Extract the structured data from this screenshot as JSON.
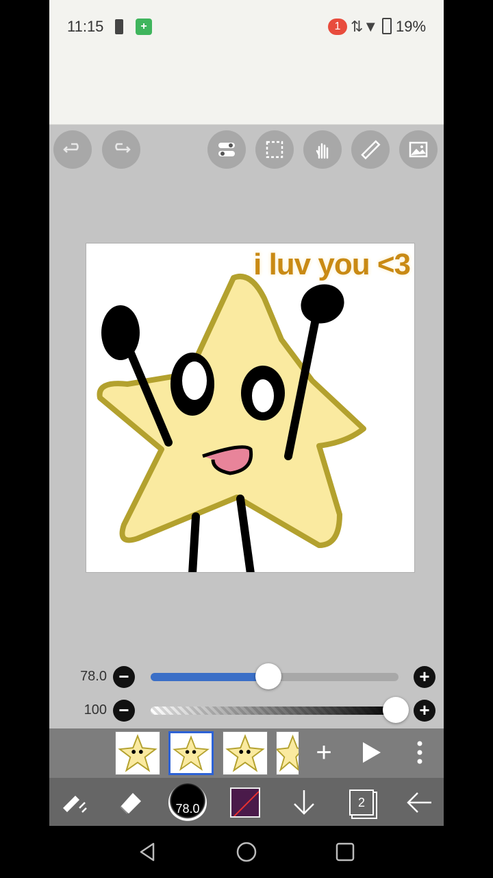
{
  "status_bar": {
    "time": "11:15",
    "notification_count": "1",
    "battery_percent": "19%"
  },
  "toolbar": {
    "undo": "undo-icon",
    "redo": "redo-icon",
    "tools": [
      "toggle-icon",
      "selection-icon",
      "hand-icon",
      "ruler-icon",
      "image-icon"
    ]
  },
  "canvas": {
    "caption": "i luv you <3"
  },
  "brush_size_slider": {
    "value": "78.0",
    "fraction": 0.475
  },
  "opacity_slider": {
    "value": "100",
    "fraction": 1.0
  },
  "frames": {
    "selected_index": 1,
    "count": 4
  },
  "bottom_toolbar": {
    "brush_size_label": "78.0",
    "layer_count": "2",
    "color": "#4a1a4a"
  }
}
